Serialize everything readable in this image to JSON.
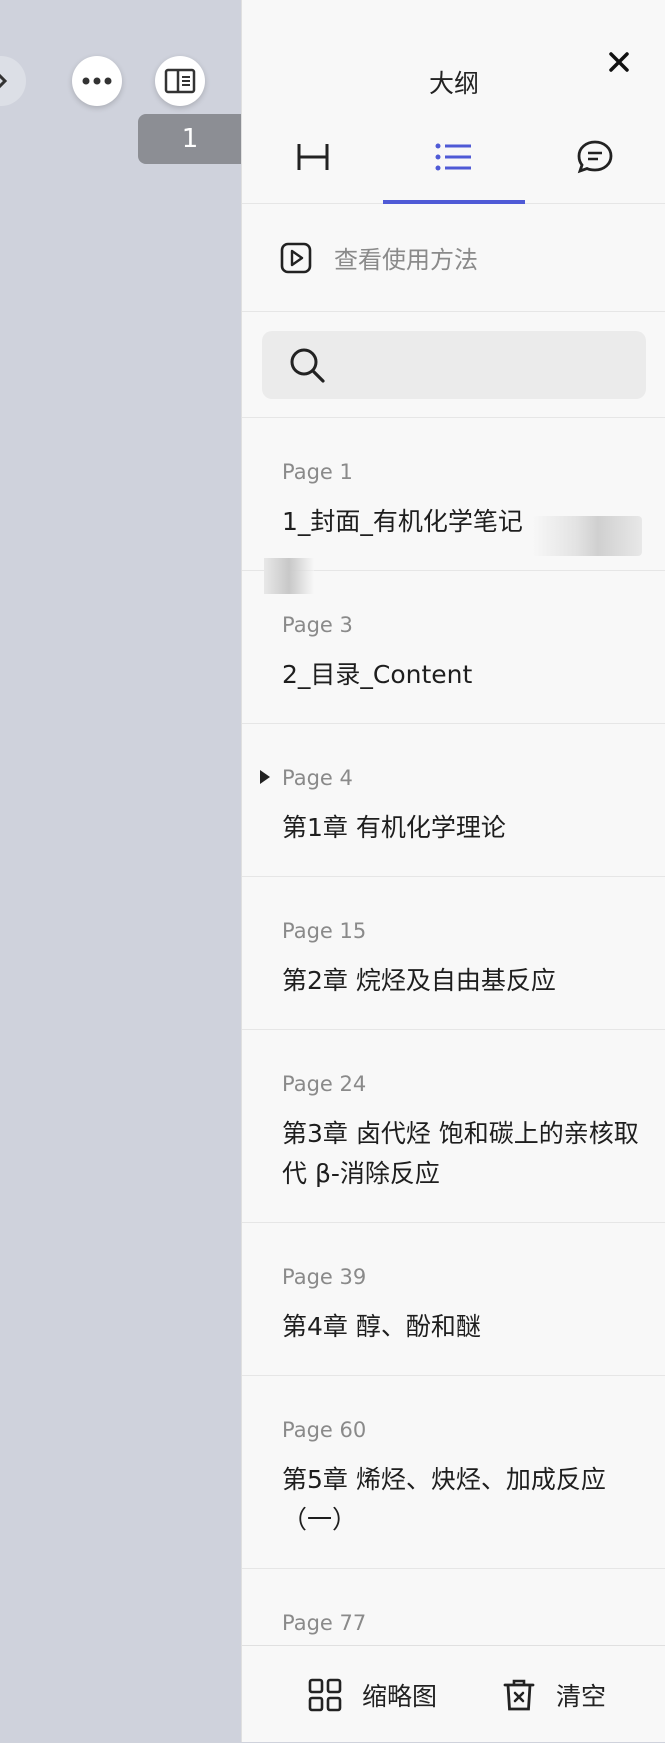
{
  "left": {
    "page_badge": "1"
  },
  "panel": {
    "title": "大纲",
    "tabs": [
      {
        "icon": "bookmark-bracket-icon"
      },
      {
        "icon": "outline-list-icon",
        "active": true
      },
      {
        "icon": "comment-icon"
      }
    ],
    "howto_label": "查看使用方法",
    "search_placeholder": ""
  },
  "outline": [
    {
      "page": "Page 1",
      "title": "1_封面_有机化学笔记"
    },
    {
      "page": "Page 3",
      "title": "2_目录_Content"
    },
    {
      "page": "Page 4",
      "title": "第1章 有机化学理论",
      "expandable": true
    },
    {
      "page": "Page 15",
      "title": "第2章 烷烃及自由基反应"
    },
    {
      "page": "Page 24",
      "title": "第3章 卤代烃 饱和碳上的亲核取代 β-消除反应"
    },
    {
      "page": "Page 39",
      "title": "第4章 醇、酚和醚"
    },
    {
      "page": "Page 60",
      "title": "第5章 烯烃、炔烃、加成反应（一）"
    },
    {
      "page": "Page 77",
      "title": ""
    }
  ],
  "bottom": {
    "thumbs_label": "缩略图",
    "clear_label": "清空"
  },
  "colors": {
    "accent": "#4f5ad6",
    "left_bg": "#cfd2dc",
    "panel_bg": "#f8f8f8"
  }
}
